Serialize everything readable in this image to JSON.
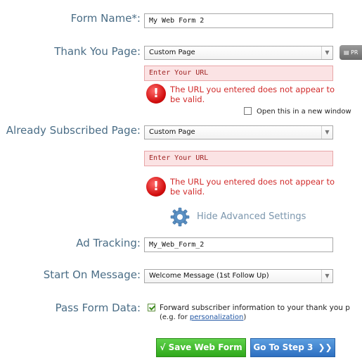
{
  "form_name": {
    "label": "Form Name*:",
    "value": "My Web Form 2"
  },
  "thank_you": {
    "label": "Thank You Page:",
    "select_value": "Custom Page",
    "url_placeholder": "Enter Your URL",
    "error": "The URL you entered does not appear to be valid.",
    "new_window_label": "Open this in a new window",
    "new_window_checked": false,
    "preview_label": "PR"
  },
  "already_subscribed": {
    "label": "Already Subscribed Page:",
    "select_value": "Custom Page",
    "url_placeholder": "Enter Your URL",
    "error": "The URL you entered does not appear to be valid."
  },
  "advanced": {
    "label": "Hide Advanced Settings",
    "icon": "gear-icon"
  },
  "ad_tracking": {
    "label": "Ad Tracking:",
    "value": "My_Web_Form_2"
  },
  "start_message": {
    "label": "Start On Message:",
    "select_value": "Welcome Message (1st Follow Up)"
  },
  "pass_form": {
    "label": "Pass Form Data:",
    "checked": true,
    "text": "Forward subscriber information to your thank you p",
    "hint_prefix": "(e.g. for ",
    "hint_link": "personalization",
    "hint_suffix": ")"
  },
  "buttons": {
    "save": "√ Save Web Form",
    "next": "Go To Step 3"
  },
  "colors": {
    "label": "#4a6d86",
    "error": "#d12b2b",
    "save": "#2fa81b",
    "next": "#2d6fc1"
  }
}
